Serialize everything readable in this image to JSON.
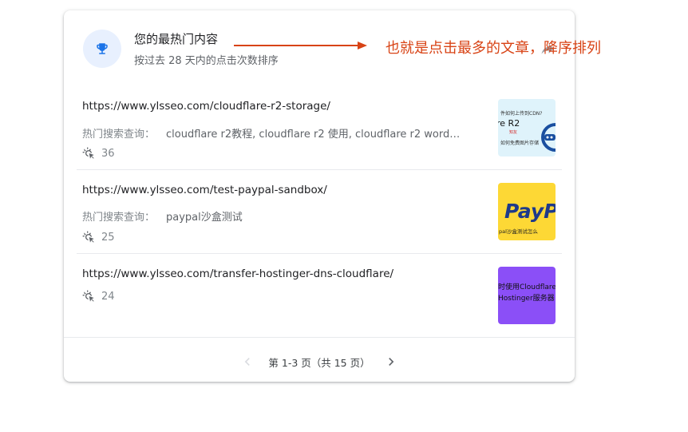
{
  "header": {
    "title": "您的最热门内容",
    "subtitle": "按过去 28 天内的点击次数排序",
    "icon": "trophy-icon",
    "accent": "#1a73e8"
  },
  "rows": [
    {
      "url": "https://www.ylsseo.com/cloudflare-r2-storage/",
      "query_label": "热门搜索查询：",
      "query_value": "cloudflare r2教程, cloudflare r2 使用, cloudflare r2 word…",
      "clicks": "36",
      "thumb": {
        "bg": "#dff3fb",
        "line1": "件如何上传到CDN?",
        "line2": "re R2",
        "line3": "知友",
        "line4": "如何免费图片存储"
      }
    },
    {
      "url": "https://www.ylsseo.com/test-paypal-sandbox/",
      "query_label": "热门搜索查询：",
      "query_value": "paypal沙盒测试",
      "clicks": "25",
      "thumb": {
        "bg": "#fdd835",
        "line1": "PayP",
        "line2": "pal沙盒测试怎么"
      }
    },
    {
      "url": "https://www.ylsseo.com/transfer-hostinger-dns-cloudflare/",
      "clicks": "24",
      "thumb": {
        "bg": "#8b4ff7",
        "line1": "时使用Cloudflare",
        "line2": "Hostinger服务器"
      }
    }
  ],
  "pagination": {
    "label": "第 1-3 页（共 15 页）"
  },
  "annotation": {
    "text": "也就是点击最多的文章，降序排列",
    "color": "#d84315"
  }
}
